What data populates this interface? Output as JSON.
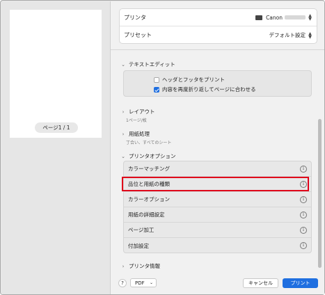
{
  "preview": {
    "page_indicator": "ページ1 / 1"
  },
  "top": {
    "printer_label": "プリンタ",
    "printer_value": "Canon",
    "preset_label": "プリセット",
    "preset_value": "デフォルト設定"
  },
  "textedit": {
    "title": "テキストエディット",
    "options": [
      {
        "label": "ヘッダとフッタをプリント",
        "checked": false
      },
      {
        "label": "内容を再度折り返してページに合わせる",
        "checked": true
      }
    ]
  },
  "layout": {
    "title": "レイアウト",
    "summary": "1ページ/枚"
  },
  "paper_handling": {
    "title": "用紙処理",
    "summary": "丁合い、すべてのシート"
  },
  "printer_options": {
    "title": "プリンタオプション",
    "items": [
      {
        "label": "カラーマッチング",
        "icon": "info-icon"
      },
      {
        "label": "品位と用紙の種類",
        "icon": "info-icon"
      },
      {
        "label": "カラーオプション",
        "icon": "info-icon"
      },
      {
        "label": "用紙の詳細設定",
        "icon": "info-icon"
      },
      {
        "label": "ページ加工",
        "icon": "info-icon"
      },
      {
        "label": "付加設定",
        "icon": "info-icon"
      }
    ],
    "highlighted_index": 1
  },
  "printer_info": {
    "title": "プリンタ情報"
  },
  "bottom": {
    "help": "?",
    "pdf": "PDF",
    "cancel": "キャンセル",
    "print": "プリント"
  },
  "colors": {
    "accent": "#1f6fe0",
    "highlight": "#e0001a"
  }
}
